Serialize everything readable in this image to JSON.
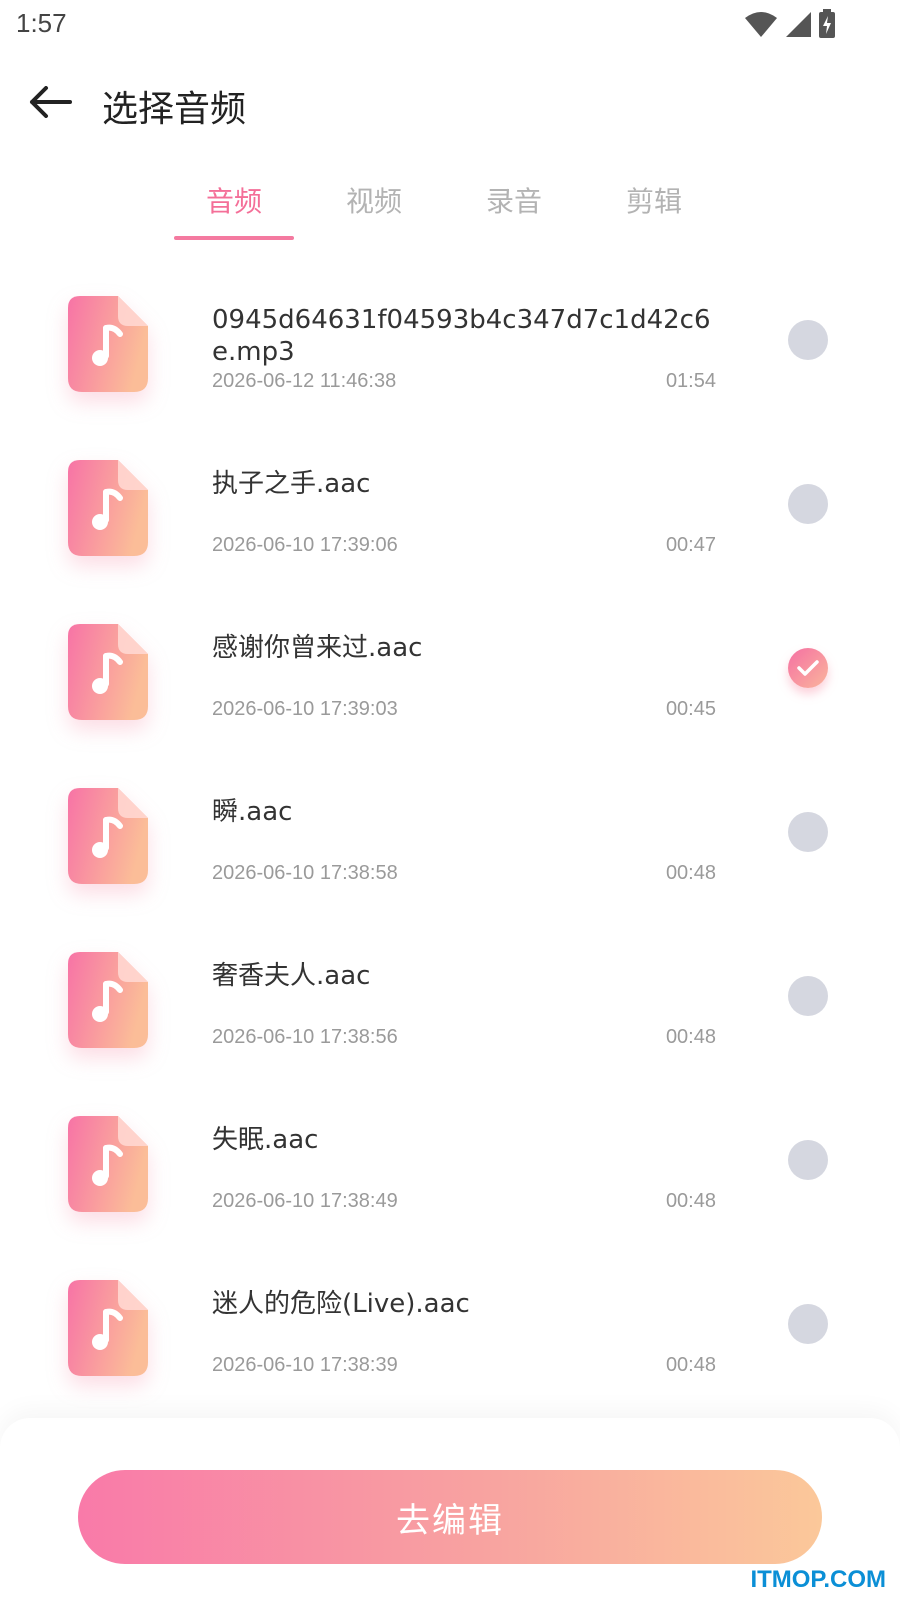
{
  "status": {
    "time": "1:57"
  },
  "header": {
    "title": "选择音频"
  },
  "tabs": [
    {
      "label": "音频",
      "active": true
    },
    {
      "label": "视频",
      "active": false
    },
    {
      "label": "录音",
      "active": false
    },
    {
      "label": "剪辑",
      "active": false
    }
  ],
  "files": [
    {
      "name": "0945d64631f04593b4c347d7c1d42c6e.mp3",
      "date": "2026-06-12 11:46:38",
      "duration": "01:54",
      "selected": false
    },
    {
      "name": "执子之手.aac",
      "date": "2026-06-10 17:39:06",
      "duration": "00:47",
      "selected": false
    },
    {
      "name": "感谢你曾来过.aac",
      "date": "2026-06-10 17:39:03",
      "duration": "00:45",
      "selected": true
    },
    {
      "name": "瞬.aac",
      "date": "2026-06-10 17:38:58",
      "duration": "00:48",
      "selected": false
    },
    {
      "name": "奢香夫人.aac",
      "date": "2026-06-10 17:38:56",
      "duration": "00:48",
      "selected": false
    },
    {
      "name": "失眠.aac",
      "date": "2026-06-10 17:38:49",
      "duration": "00:48",
      "selected": false
    },
    {
      "name": "迷人的危险(Live).aac",
      "date": "2026-06-10 17:38:39",
      "duration": "00:48",
      "selected": false
    }
  ],
  "footer": {
    "edit_label": "去编辑"
  },
  "watermark": "ITMOP.COM",
  "colors": {
    "accent": "#f46f98",
    "gradient_start": "#f97aa9",
    "gradient_end": "#fbc89a",
    "radio_off": "#d5d7e0"
  },
  "icons": {
    "back": "arrow-left-icon",
    "file": "music-file-icon",
    "wifi": "wifi-icon",
    "signal": "signal-icon",
    "battery": "battery-icon",
    "check": "check-icon"
  }
}
